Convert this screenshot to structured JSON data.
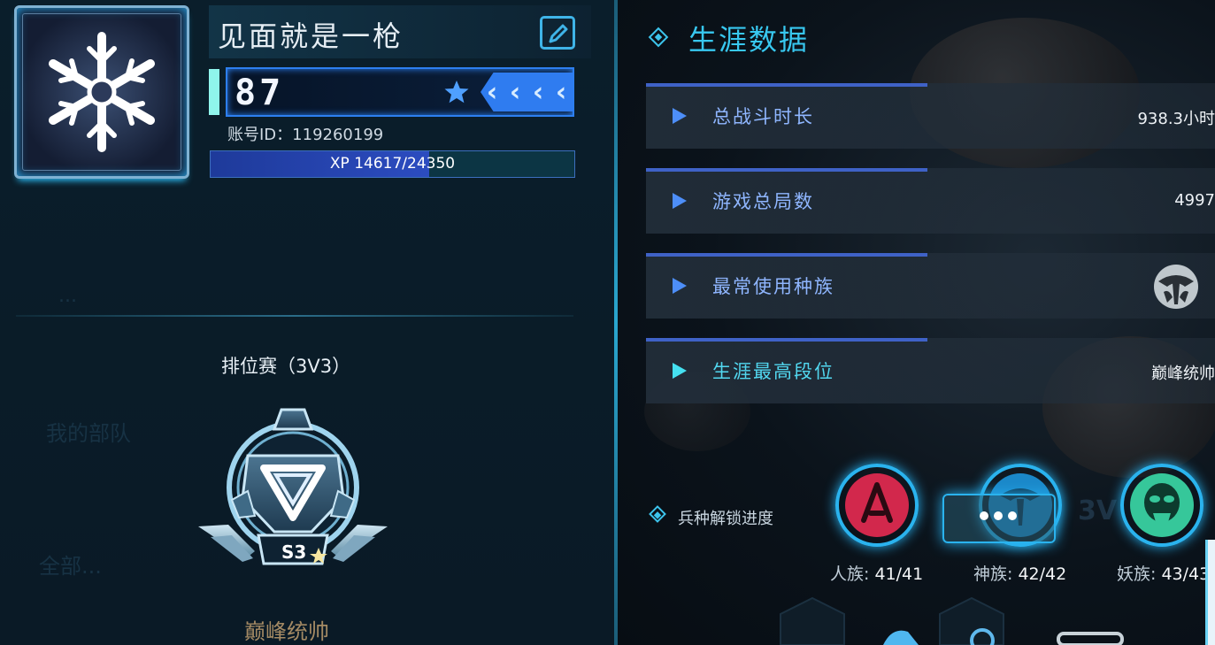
{
  "player": {
    "name": "见面就是一枪",
    "level": "87",
    "account_id": "账号ID：119260199",
    "xp_text": "XP 14617/24350",
    "xp_progress": 0.6
  },
  "left_panel": {
    "faded_labels": [
      "...",
      "我的部队",
      "全部..."
    ],
    "ranked_label": "排位赛（3V3）",
    "season_badge": "S3",
    "tier_name": "巅峰统帅"
  },
  "career": {
    "title": "生涯数据",
    "stats": [
      {
        "label": "总战斗时长",
        "value": "938.3小时"
      },
      {
        "label": "游戏总局数",
        "value": "4997"
      },
      {
        "label": "最常使用种族",
        "value": ""
      },
      {
        "label": "生涯最高段位",
        "value": "巅峰统帅"
      }
    ],
    "unlock_title": "兵种解锁进度",
    "races": [
      {
        "name": "人族:",
        "count": "41/41"
      },
      {
        "name": "神族:",
        "count": "42/42"
      },
      {
        "name": "妖族:",
        "count": "43/43"
      }
    ]
  },
  "icons": [
    "snowflake-icon",
    "edit-icon",
    "star-icon",
    "chevrons-icon",
    "rank-emblem-icon",
    "race-icon",
    "human-race-icon",
    "divine-race-icon",
    "demon-race-icon",
    "more-icon"
  ],
  "colors": {
    "accent": "#38c8f0",
    "level_border": "#2d7ff0",
    "xp_fill": "#2c4cc0",
    "tier_gold": "#a48a64"
  }
}
